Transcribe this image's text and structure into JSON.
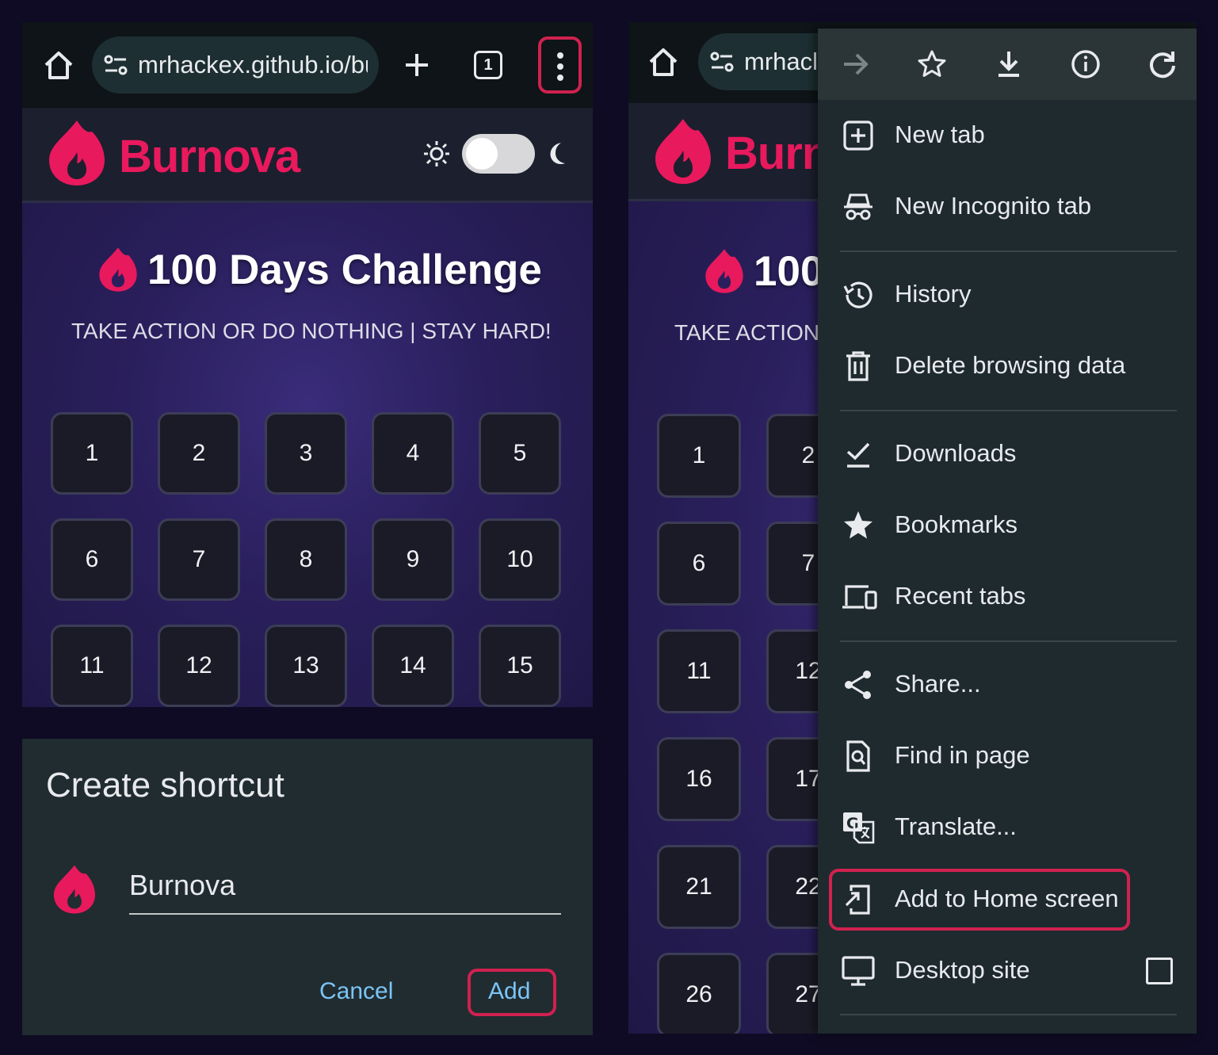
{
  "left": {
    "url": "mrhackex.github.io/bu",
    "tab_count": "1",
    "brand": "Burnova",
    "challenge_title": "100 Days Challenge",
    "subtitle": "TAKE ACTION OR DO NOTHING | STAY HARD!",
    "days": [
      "1",
      "2",
      "3",
      "4",
      "5",
      "6",
      "7",
      "8",
      "9",
      "10",
      "11",
      "12",
      "13",
      "14",
      "15"
    ]
  },
  "dialog": {
    "title": "Create shortcut",
    "name_value": "Burnova",
    "cancel_label": "Cancel",
    "add_label": "Add"
  },
  "right": {
    "url": "mrhacl",
    "brand": "Burn",
    "challenge_title": "100",
    "subtitle": "TAKE ACTION",
    "rows": [
      [
        "1",
        "2"
      ],
      [
        "6",
        "7"
      ],
      [
        "11",
        "12"
      ],
      [
        "16",
        "17"
      ],
      [
        "21",
        "22"
      ],
      [
        "26",
        "27"
      ]
    ]
  },
  "menu": {
    "top_icons": [
      "forward-icon",
      "bookmark-star-icon",
      "download-icon",
      "info-icon",
      "reload-icon"
    ],
    "items": [
      {
        "label": "New tab",
        "icon": "new-tab-icon"
      },
      {
        "label": "New Incognito tab",
        "icon": "incognito-icon"
      },
      {
        "label": "History",
        "icon": "history-icon"
      },
      {
        "label": "Delete browsing data",
        "icon": "trash-icon"
      },
      {
        "label": "Downloads",
        "icon": "downloads-check-icon"
      },
      {
        "label": "Bookmarks",
        "icon": "star-icon"
      },
      {
        "label": "Recent tabs",
        "icon": "devices-icon"
      },
      {
        "label": "Share...",
        "icon": "share-icon"
      },
      {
        "label": "Find in page",
        "icon": "find-in-page-icon"
      },
      {
        "label": "Translate...",
        "icon": "translate-icon"
      },
      {
        "label": "Add to Home screen",
        "icon": "add-to-home-icon"
      },
      {
        "label": "Desktop site",
        "icon": "desktop-icon"
      }
    ]
  },
  "colors": {
    "brand": "#e8195d",
    "highlight": "#d0214f",
    "link_blue": "#7cc4f5",
    "menu_bg": "#1e2a2e"
  }
}
